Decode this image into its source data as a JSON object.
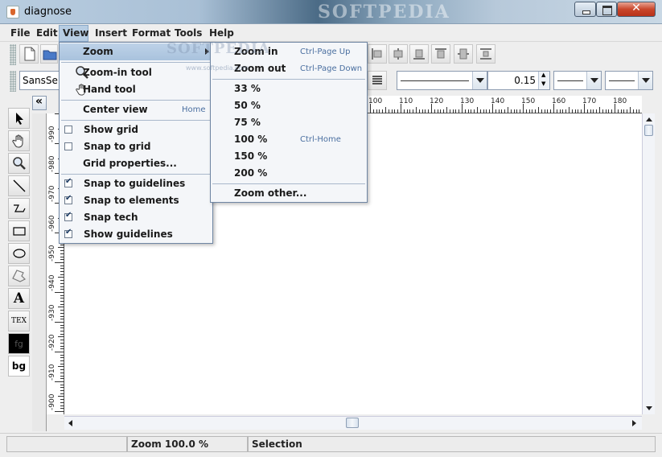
{
  "window": {
    "title": "diagnose",
    "watermark": "SOFTPEDIA",
    "watermark_url": "www.softpedia.com"
  },
  "menubar": {
    "items": [
      "File",
      "Edit",
      "View",
      "Insert",
      "Format",
      "Tools",
      "Help"
    ]
  },
  "toolbar2": {
    "font_family": "SansSe",
    "line_width": "0.15"
  },
  "palette": {
    "text_tool": "A",
    "tex_tool": "TEX",
    "fg": "fg",
    "bg": "bg"
  },
  "rulers": {
    "top": [
      "100",
      "110",
      "120",
      "130",
      "140",
      "150",
      "160",
      "170",
      "180"
    ],
    "left": [
      "-990",
      "-980",
      "-970",
      "-960",
      "-950",
      "-940",
      "-930",
      "-920",
      "-910",
      "-900"
    ]
  },
  "view_menu": {
    "items": [
      {
        "label": "Zoom",
        "submenu": true
      },
      {
        "label": "Zoom-in tool"
      },
      {
        "label": "Hand tool"
      },
      {
        "label": "Center view",
        "accelerator": "Home"
      },
      {
        "label": "Show grid",
        "checked": false
      },
      {
        "label": "Snap to grid",
        "checked": false
      },
      {
        "label": "Grid properties..."
      },
      {
        "label": "Snap to guidelines",
        "checked": true
      },
      {
        "label": "Snap to elements",
        "checked": true
      },
      {
        "label": "Snap tech",
        "checked": true
      },
      {
        "label": "Show guidelines",
        "checked": true
      }
    ]
  },
  "zoom_menu": {
    "items": [
      {
        "label": "Zoom in",
        "accelerator": "Ctrl-Page Up"
      },
      {
        "label": "Zoom out",
        "accelerator": "Ctrl-Page Down"
      },
      {
        "label": "33 %"
      },
      {
        "label": "50 %"
      },
      {
        "label": "75 %"
      },
      {
        "label": "100 %",
        "accelerator": "Ctrl-Home"
      },
      {
        "label": "150 %"
      },
      {
        "label": "200 %"
      },
      {
        "label": "Zoom other..."
      }
    ]
  },
  "statusbar": {
    "zoom": "Zoom 100.0 %",
    "mode": "Selection"
  },
  "colors": {
    "menu_highlight": "#b7cde3",
    "accelerator": "#4a6fa0",
    "menu_border": "#6f86a3"
  }
}
